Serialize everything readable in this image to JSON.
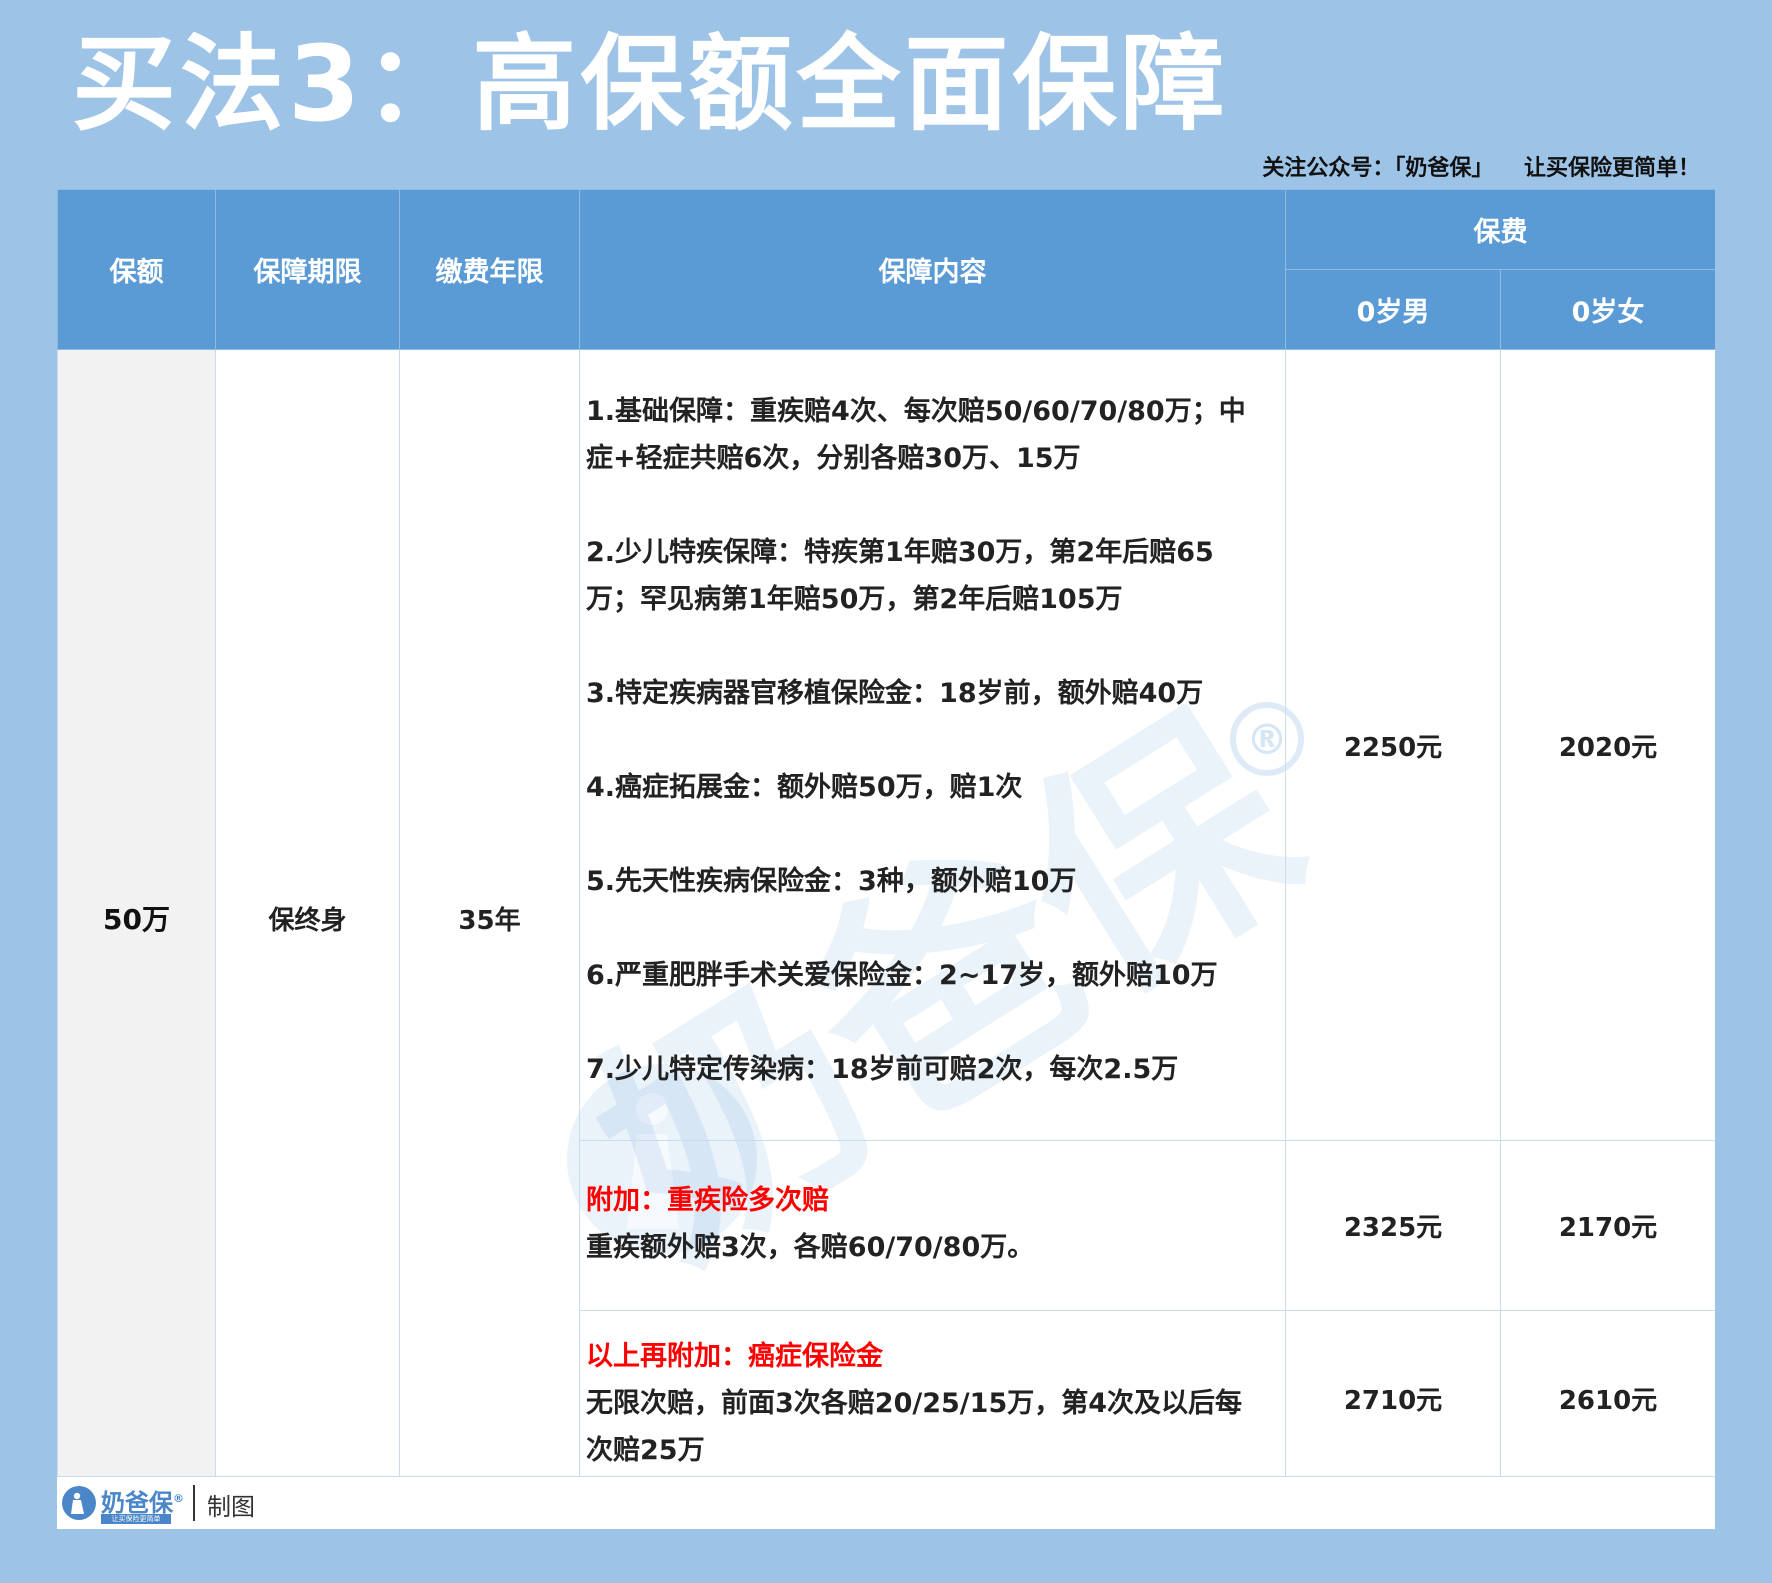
{
  "title": "买法3：高保额全面保障",
  "follow": "关注公众号：「奶爸保」    让买保险更简单！",
  "table": {
    "headers": {
      "amount": "保额",
      "period": "保障期限",
      "payment": "缴费年限",
      "content": "保障内容",
      "premium": "保费",
      "male": "0岁男",
      "female": "0岁女"
    },
    "row": {
      "amount": "50万",
      "period": "保终身",
      "payment": "35年"
    },
    "base_items": [
      "1.基础保障：重疾赔4次、每次赔50/60/70/80万；中症+轻症共赔6次，分别各赔30万、15万",
      "2.少儿特疾保障：特疾第1年赔30万，第2年后赔65万；罕见病第1年赔50万，第2年后赔105万",
      "3.特定疾病器官移植保险金：18岁前，额外赔40万",
      "4.癌症拓展金：额外赔50万，赔1次",
      "5.先天性疾病保险金：3种，额外赔10万",
      "6.严重肥胖手术关爱保险金：2~17岁，额外赔10万",
      "7.少儿特定传染病：18岁前可赔2次，每次2.5万"
    ],
    "base_male": "2250元",
    "base_female": "2020元",
    "addon1": {
      "title": "附加：重疾险多次赔",
      "desc": "重疾额外赔3次，各赔60/70/80万。",
      "male": "2325元",
      "female": "2170元"
    },
    "addon2": {
      "title": "以上再附加：癌症保险金",
      "desc": "无限次赔，前面3次各赔20/25/15万，第4次及以后每次赔25万",
      "male": "2710元",
      "female": "2610元"
    }
  },
  "footer": {
    "brand": "奶爸保",
    "brand_mark": "®",
    "slogan": "让买保险更简单",
    "made": "制图"
  },
  "watermark": {
    "text": "奶爸保",
    "mark": "®"
  },
  "colors": {
    "background": "#9dc3e6",
    "header": "#5b9bd5",
    "highlight_red": "#ff0000",
    "amount_column": "#f2f2f2"
  }
}
